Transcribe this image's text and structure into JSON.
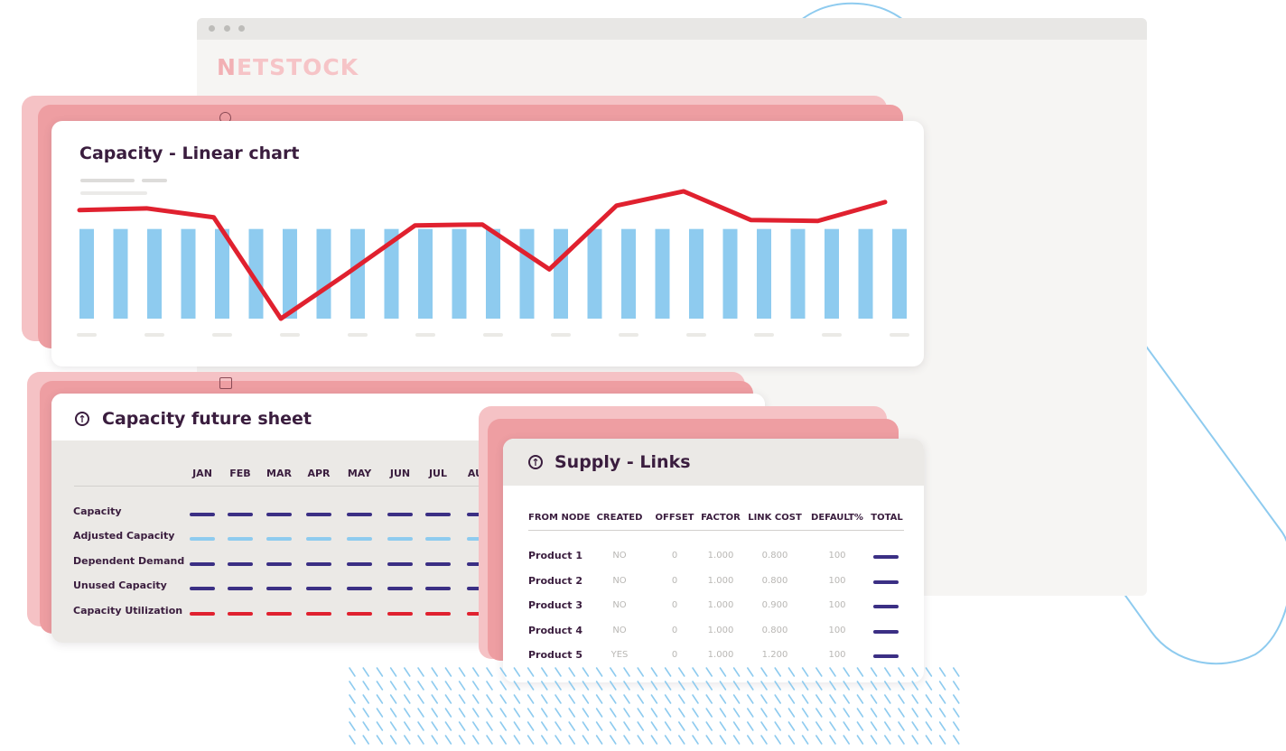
{
  "app": {
    "logo": "NETSTOCK",
    "logo_first": "N",
    "logo_rest": "ETSTOCK"
  },
  "colors": {
    "brand_pink": "#ee9ea2",
    "bar_blue": "#8ecbef",
    "line_red": "#e0212f",
    "dash_navy": "#3b2f84",
    "dash_light_blue": "#8ecbef",
    "dash_red": "#e0212f",
    "deco_blue": "#8ecbef"
  },
  "linear_chart": {
    "title": "Capacity - Linear chart"
  },
  "chart_data": {
    "type": "bar",
    "title": "Capacity - Linear chart",
    "bar_count": 25,
    "bar_values": [
      100,
      100,
      100,
      100,
      100,
      100,
      100,
      100,
      100,
      100,
      100,
      100,
      100,
      100,
      100,
      100,
      100,
      100,
      100,
      100,
      100,
      100,
      100,
      100,
      100
    ],
    "line_series": [
      {
        "values": [
          121,
          123,
          113,
          0,
          51,
          104,
          105,
          55,
          126,
          142,
          110,
          109,
          130
        ]
      }
    ],
    "ylim": [
      0,
      150
    ],
    "grid": false
  },
  "future_sheet": {
    "title": "Capacity future sheet",
    "icon": "arrow-up-circle-icon",
    "months": [
      "JAN",
      "FEB",
      "MAR",
      "APR",
      "MAY",
      "JUN",
      "JUL",
      "AUG"
    ],
    "rows": [
      {
        "label": "Capacity",
        "color": "#3b2f84"
      },
      {
        "label": "Adjusted Capacity",
        "color": "#8ecbef"
      },
      {
        "label": "Dependent Demand",
        "color": "#3b2f84"
      },
      {
        "label": "Unused Capacity",
        "color": "#3b2f84"
      },
      {
        "label": "Capacity Utilization",
        "color": "#e0212f"
      }
    ]
  },
  "supply_links": {
    "title": "Supply - Links",
    "icon": "arrow-up-circle-icon",
    "columns": [
      "FROM NODE",
      "CREATED",
      "OFFSET",
      "FACTOR",
      "LINK COST",
      "DEFAULT%",
      "TOTAL"
    ],
    "rows": [
      {
        "node": "Product 1",
        "created": "NO",
        "offset": "0",
        "factor": "1.000",
        "link_cost": "0.800",
        "default": "100"
      },
      {
        "node": "Product 2",
        "created": "NO",
        "offset": "0",
        "factor": "1.000",
        "link_cost": "0.800",
        "default": "100"
      },
      {
        "node": "Product 3",
        "created": "NO",
        "offset": "0",
        "factor": "1.000",
        "link_cost": "0.900",
        "default": "100"
      },
      {
        "node": "Product 4",
        "created": "NO",
        "offset": "0",
        "factor": "1.000",
        "link_cost": "0.800",
        "default": "100"
      },
      {
        "node": "Product 5",
        "created": "YES",
        "offset": "0",
        "factor": "1.000",
        "link_cost": "1.200",
        "default": "100"
      }
    ]
  }
}
